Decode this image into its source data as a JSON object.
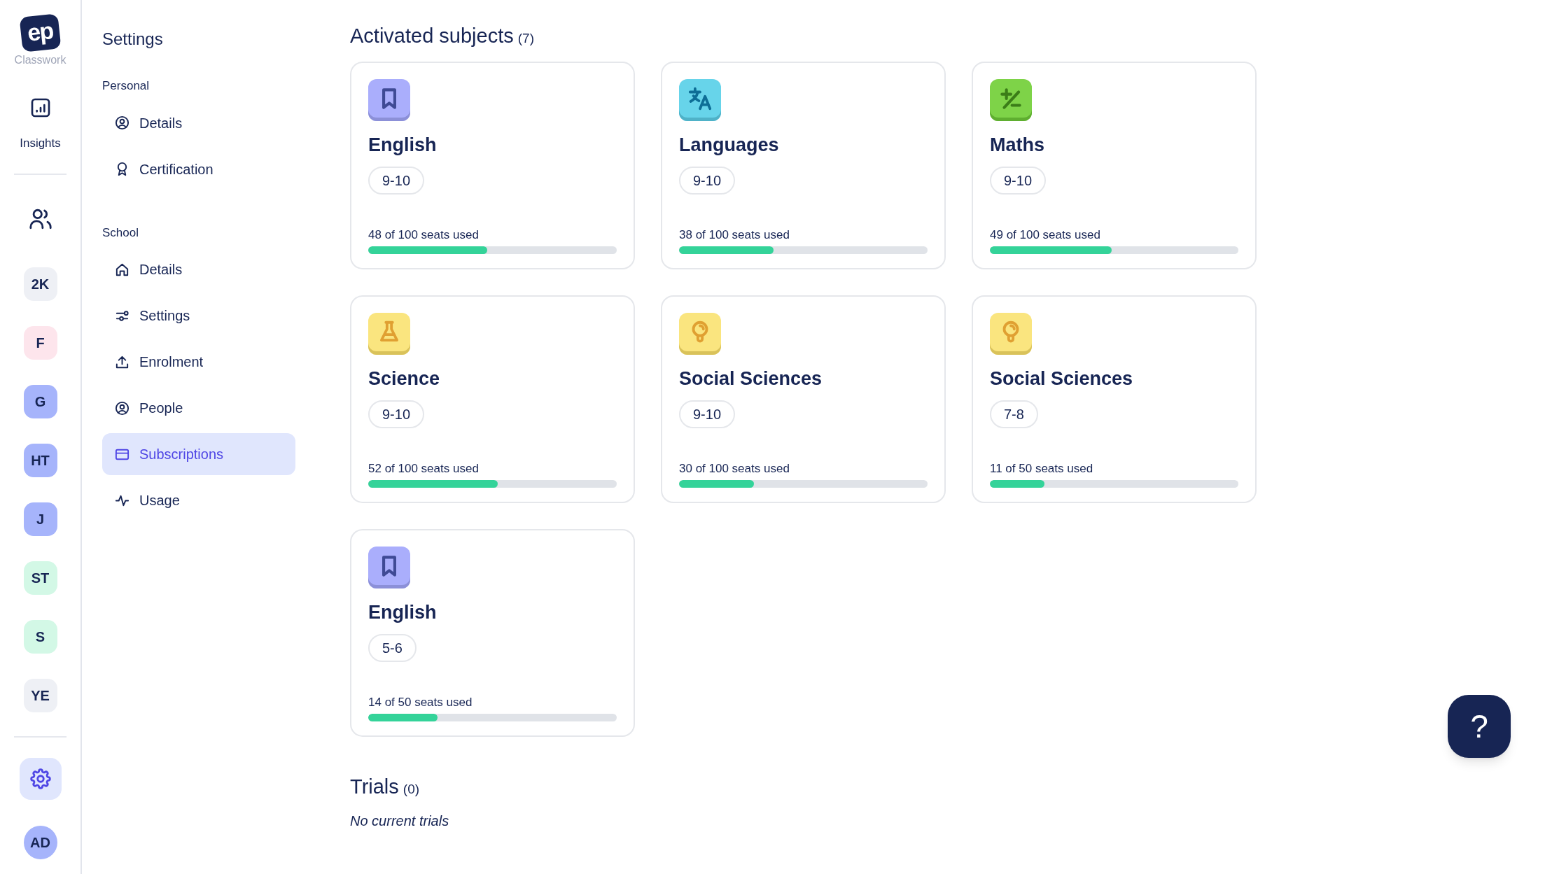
{
  "rail": {
    "logo": "ep",
    "app_name": "Classwork",
    "insights": "Insights",
    "classes": [
      {
        "label": "2K",
        "color": "#eef0f5"
      },
      {
        "label": "F",
        "color": "#fde5ec"
      },
      {
        "label": "G",
        "color": "#a6b4fb"
      },
      {
        "label": "HT",
        "color": "#a6b4fb"
      },
      {
        "label": "J",
        "color": "#a6b4fb"
      },
      {
        "label": "ST",
        "color": "#d3f8e6"
      },
      {
        "label": "S",
        "color": "#d3f8e6"
      },
      {
        "label": "YE",
        "color": "#eef0f5"
      }
    ],
    "user": "AD"
  },
  "sidebar": {
    "title": "Settings",
    "sections": [
      {
        "heading": "Personal",
        "items": [
          {
            "label": "Details",
            "kind": "user",
            "selected": false
          },
          {
            "label": "Certification",
            "kind": "award",
            "selected": false
          }
        ]
      },
      {
        "heading": "School",
        "items": [
          {
            "label": "Details",
            "kind": "home",
            "selected": false
          },
          {
            "label": "Settings",
            "kind": "sliders",
            "selected": false
          },
          {
            "label": "Enrolment",
            "kind": "upload",
            "selected": false
          },
          {
            "label": "People",
            "kind": "user",
            "selected": false
          },
          {
            "label": "Subscriptions",
            "kind": "card",
            "selected": true
          },
          {
            "label": "Usage",
            "kind": "pulse",
            "selected": false
          }
        ]
      }
    ]
  },
  "activated": {
    "title": "Activated subjects",
    "count": "(7)",
    "subjects": [
      {
        "name": "English",
        "kind": "bookmark",
        "years": "9-10",
        "seats": "48 of 100 seats used",
        "level": 0.48
      },
      {
        "name": "Languages",
        "kind": "translate",
        "years": "9-10",
        "seats": "38 of 100 seats used",
        "level": 0.38
      },
      {
        "name": "Maths",
        "kind": "maths",
        "years": "9-10",
        "seats": "49 of 100 seats used",
        "level": 0.49
      },
      {
        "name": "Science",
        "kind": "flask",
        "years": "9-10",
        "seats": "52 of 100 seats used",
        "level": 0.52
      },
      {
        "name": "Social Sciences",
        "kind": "bulb",
        "years": "9-10",
        "seats": "30 of 100 seats used",
        "level": 0.3
      },
      {
        "name": "Social Sciences",
        "kind": "bulb",
        "years": "7-8",
        "seats": "11 of 50 seats used",
        "level": 0.22
      },
      {
        "name": "English",
        "kind": "bookmark",
        "years": "5-6",
        "seats": "14 of 50 seats used",
        "level": 0.28
      }
    ]
  },
  "trials": {
    "title": "Trials",
    "count": "(0)",
    "empty": "No current trials"
  },
  "help_button": "?"
}
